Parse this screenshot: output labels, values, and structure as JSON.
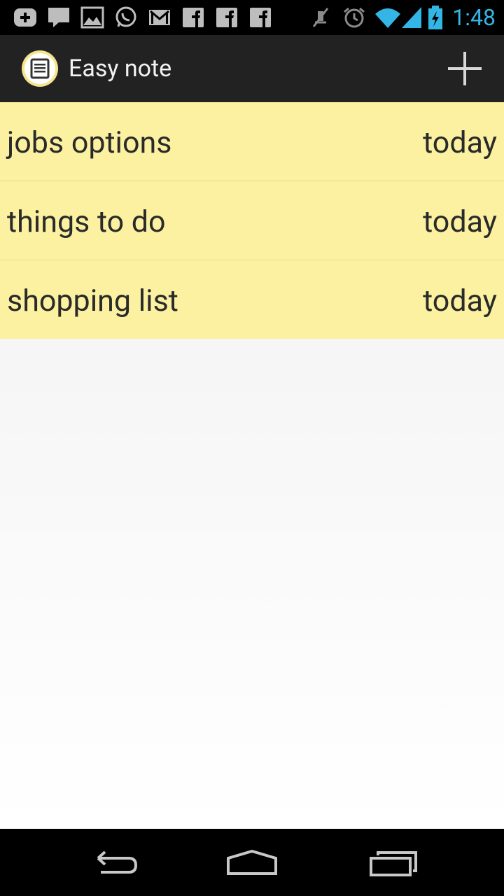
{
  "status_bar": {
    "time": "1:48",
    "left_icons": [
      "add-notification-icon",
      "message-icon",
      "image-icon",
      "whatsapp-icon",
      "gmail-icon",
      "facebook-icon",
      "facebook-icon",
      "facebook-icon"
    ],
    "right_icons": [
      "mute-icon",
      "alarm-icon",
      "wifi-icon",
      "signal-icon",
      "battery-charging-icon"
    ],
    "accent_color": "#33b5e5"
  },
  "action_bar": {
    "title": "Easy note",
    "app_icon": "note-icon",
    "add_icon": "plus-icon"
  },
  "notes": [
    {
      "title": "jobs options",
      "date": "today"
    },
    {
      "title": "things to do",
      "date": "today"
    },
    {
      "title": "shopping list",
      "date": "today"
    }
  ],
  "nav_bar": {
    "buttons": [
      "back-icon",
      "home-icon",
      "recent-apps-icon"
    ]
  },
  "colors": {
    "note_background": "#fbf1a0",
    "action_bar": "#222222"
  }
}
